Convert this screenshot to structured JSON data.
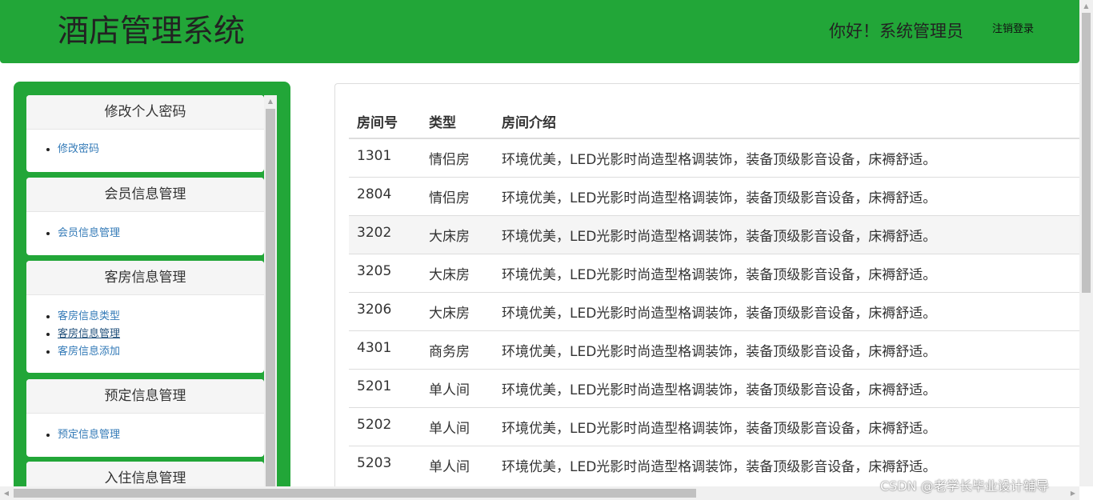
{
  "header": {
    "app_title": "酒店管理系统",
    "greeting": "你好！系统管理员",
    "logout_label": "注销登录"
  },
  "sidebar": {
    "panels": [
      {
        "title": "修改个人密码",
        "items": [
          "修改密码"
        ]
      },
      {
        "title": "会员信息管理",
        "items": [
          "会员信息管理"
        ]
      },
      {
        "title": "客房信息管理",
        "items": [
          "客房信息类型",
          "客房信息管理",
          "客房信息添加"
        ],
        "active_index": 1
      },
      {
        "title": "预定信息管理",
        "items": [
          "预定信息管理"
        ]
      },
      {
        "title": "入住信息管理",
        "items": []
      }
    ]
  },
  "table": {
    "headers": [
      "房间号",
      "类型",
      "房间介绍"
    ],
    "rows": [
      {
        "room": "1301",
        "type": "情侣房",
        "desc": "环境优美，LED光影时尚造型格调装饰，装备顶级影音设备，床褥舒适。"
      },
      {
        "room": "2804",
        "type": "情侣房",
        "desc": "环境优美，LED光影时尚造型格调装饰，装备顶级影音设备，床褥舒适。"
      },
      {
        "room": "3202",
        "type": "大床房",
        "desc": "环境优美，LED光影时尚造型格调装饰，装备顶级影音设备，床褥舒适。"
      },
      {
        "room": "3205",
        "type": "大床房",
        "desc": "环境优美，LED光影时尚造型格调装饰，装备顶级影音设备，床褥舒适。"
      },
      {
        "room": "3206",
        "type": "大床房",
        "desc": "环境优美，LED光影时尚造型格调装饰，装备顶级影音设备，床褥舒适。"
      },
      {
        "room": "4301",
        "type": "商务房",
        "desc": "环境优美，LED光影时尚造型格调装饰，装备顶级影音设备，床褥舒适。"
      },
      {
        "room": "5201",
        "type": "单人间",
        "desc": "环境优美，LED光影时尚造型格调装饰，装备顶级影音设备，床褥舒适。"
      },
      {
        "room": "5202",
        "type": "单人间",
        "desc": "环境优美，LED光影时尚造型格调装饰，装备顶级影音设备，床褥舒适。"
      },
      {
        "room": "5203",
        "type": "单人间",
        "desc": "环境优美，LED光影时尚造型格调装饰，装备顶级影音设备，床褥舒适。"
      }
    ]
  },
  "watermark": "CSDN @老学长毕业设计辅导",
  "colors": {
    "brand_green": "#22a638",
    "link_blue": "#337ab7"
  },
  "icons": {
    "scroll_up": "triangle-up-icon",
    "scroll_left": "triangle-left-icon",
    "scroll_right": "triangle-right-icon"
  }
}
